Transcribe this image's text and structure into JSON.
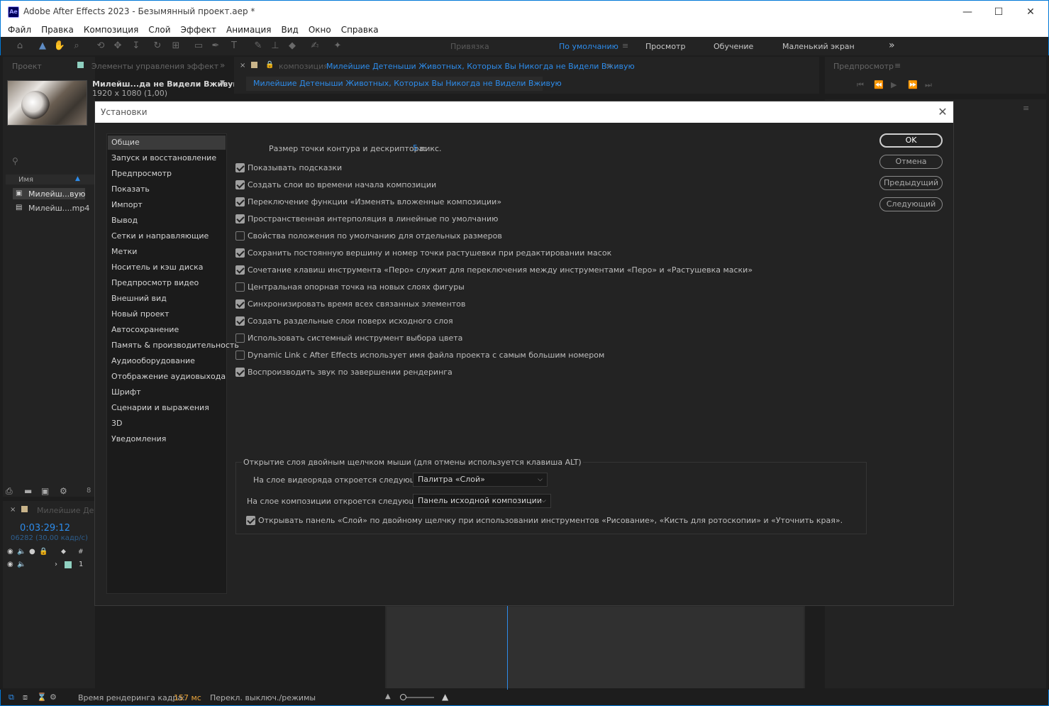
{
  "window": {
    "title": "Adobe After Effects 2023 - Безымянный проект.aep *",
    "app_icon": "Ae",
    "minimize": "—",
    "maximize": "☐",
    "close": "✕"
  },
  "menu": [
    "Файл",
    "Правка",
    "Композиция",
    "Слой",
    "Эффект",
    "Анимация",
    "Вид",
    "Окно",
    "Справка"
  ],
  "toolbar": {
    "snap_label": "Привязка",
    "workspaces": [
      "По умолчанию",
      "Просмотр",
      "Обучение",
      "Маленький экран"
    ],
    "overflow": "»"
  },
  "project_panel": {
    "tab_project": "Проект",
    "tab_effects": "Элементы управления эффект",
    "comp_name": "Милейш...да не Видели Вживую",
    "comp_res": "1920 x 1080 (1,00)",
    "col_name": "Имя",
    "items": [
      "Милейш...вую",
      "Милейш....mp4"
    ],
    "bottom_num": "8"
  },
  "composition_panel": {
    "tab_prefix": "композиция",
    "tab_name": "Милейшие Детеныши Животных, Которых Вы Никогда не Видели Вживую",
    "sub_tab": "Милейшие Детеныши Животных, Которых Вы Никогда не Видели Вживую"
  },
  "preview_panel": {
    "title": "Предпросмотр"
  },
  "timeline": {
    "tab": "Милейшие Дете",
    "timecode": "0:03:29:12",
    "frames": "06282 (30,00 кадр/с)",
    "layer_num": "1"
  },
  "status": {
    "render_label": "Время рендеринга кадра:",
    "render_value": "157 мс",
    "switch_label": "Перекл. выключ./режимы"
  },
  "dialog": {
    "title": "Установки",
    "close": "✕",
    "categories": [
      "Общие",
      "Запуск и восстановление",
      "Предпросмотр",
      "Показать",
      "Импорт",
      "Вывод",
      "Сетки и направляющие",
      "Метки",
      "Носитель и кэш диска",
      "Предпросмотр видео",
      "Внешний вид",
      "Новый проект",
      "Автосохранение",
      "Память & производительность",
      "Аудиооборудование",
      "Отображение аудиовыхода",
      "Шрифт",
      "Сценарии и выражения",
      "3D",
      "Уведомления"
    ],
    "path_point_label": "Размер точки контура и дескриптора:",
    "path_point_value": "5",
    "path_point_unit": "пикс.",
    "options": [
      {
        "label": "Показывать подсказки",
        "checked": true
      },
      {
        "label": "Создать слои во времени начала композиции",
        "checked": true
      },
      {
        "label": "Переключение функции «Изменять вложенные композиции»",
        "checked": true
      },
      {
        "label": "Пространственная интерполяция в линейные по умолчанию",
        "checked": true
      },
      {
        "label": "Свойства положения по умолчанию для отдельных размеров",
        "checked": false
      },
      {
        "label": "Сохранить постоянную вершину и номер точки растушевки при редактировании масок",
        "checked": true
      },
      {
        "label": "Сочетание клавиш инструмента «Перо» служит для переключения между инструментами «Перо» и «Растушевка маски»",
        "checked": true
      },
      {
        "label": "Центральная опорная точка на новых слоях фигуры",
        "checked": false
      },
      {
        "label": "Синхронизировать время всех связанных элементов",
        "checked": true
      },
      {
        "label": "Создать раздельные слои поверх исходного слоя",
        "checked": true
      },
      {
        "label": "Использовать системный инструмент выбора цвета",
        "checked": false
      },
      {
        "label": "Dynamic Link с After Effects использует имя файла проекта с самым большим номером",
        "checked": false
      },
      {
        "label": "Воспроизводить звук по завершении рендеринга",
        "checked": true
      }
    ],
    "group_title": "Открытие слоя двойным щелчком мыши (для отмены используется клавиша ALT)",
    "footage_label": "На слое видеоряда откроется следующее:",
    "footage_value": "Палитра «Слой»",
    "comp_label": "На слое композиции откроется следующее:",
    "comp_value": "Панель исходной композиции",
    "paint_option": {
      "label": "Открывать панель «Слой» по двойному щелчку при использовании инструментов «Рисование», «Кисть для ротоскопии» и «Уточнить края».",
      "checked": true
    },
    "buttons": {
      "ok": "OK",
      "cancel": "Отмена",
      "prev": "Предыдущий",
      "next": "Следующий"
    }
  }
}
